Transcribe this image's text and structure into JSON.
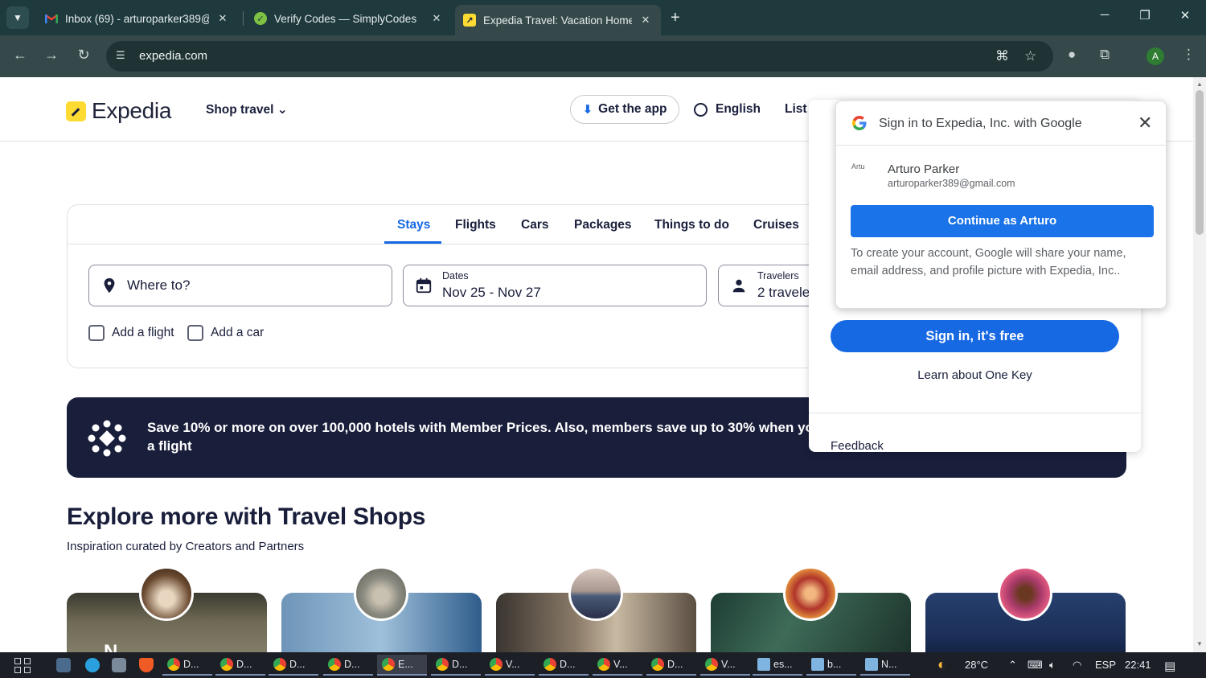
{
  "browser": {
    "tabs": [
      {
        "title": "Inbox (69) - arturoparker389@g",
        "favicon": "gmail-icon"
      },
      {
        "title": "Verify Codes — SimplyCodes",
        "favicon": "simplycodes-icon"
      },
      {
        "title": "Expedia Travel: Vacation Homes",
        "favicon": "expedia-icon",
        "active": true
      }
    ],
    "url": "expedia.com",
    "profile_initial": "A"
  },
  "header": {
    "logo_text": "Expedia",
    "shop_travel": "Shop travel",
    "get_app": "Get the app",
    "language": "English",
    "list_your": "List your"
  },
  "search": {
    "tabs": [
      "Stays",
      "Flights",
      "Cars",
      "Packages",
      "Things to do",
      "Cruises"
    ],
    "active_tab": "Stays",
    "where_placeholder": "Where to?",
    "dates_label": "Dates",
    "dates_value": "Nov 25 - Nov 27",
    "travelers_label": "Travelers",
    "travelers_value": "2 travele",
    "add_flight": "Add a flight",
    "add_car": "Add a car"
  },
  "banner": {
    "text": "Save 10% or more on over 100,000 hotels with Member Prices. Also, members save up to 30% when yo to a flight"
  },
  "explore": {
    "title": "Explore more with Travel Shops",
    "subtitle": "Inspiration curated by Creators and Partners",
    "first_card_title": "N..."
  },
  "signin_panel": {
    "signin_button": "Sign in, it's free",
    "learn_link": "Learn about One Key",
    "feedback": "Feedback"
  },
  "google_popup": {
    "title": "Sign in to Expedia, Inc. with Google",
    "avatar_alt": "Artu",
    "name": "Arturo Parker",
    "email": "arturoparker389@gmail.com",
    "continue_button": "Continue as Arturo",
    "disclosure": "To create your account, Google will share your name, email address, and profile picture with Expedia, Inc.."
  },
  "taskbar": {
    "apps": [
      "D...",
      "D...",
      "D...",
      "D...",
      "E...",
      "D...",
      "V...",
      "D...",
      "V...",
      "D...",
      "V...",
      "es...",
      "b...",
      "N..."
    ],
    "temperature": "28°C",
    "language": "ESP",
    "time": "22:41"
  },
  "colors": {
    "brand_blue": "#1668e3",
    "google_blue": "#1a73e8",
    "banner_navy": "#191e3b",
    "logo_yellow": "#fddb32"
  }
}
